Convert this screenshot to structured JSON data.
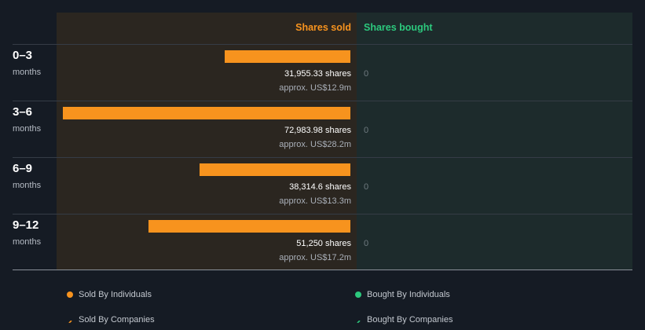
{
  "header": {
    "sold_label": "Shares sold",
    "bought_label": "Shares bought"
  },
  "rows": [
    {
      "period": "0–3",
      "unit": "months",
      "shares_text": "31,955.33 shares",
      "approx_text": "approx. US$12.9m",
      "bought_text": "0"
    },
    {
      "period": "3–6",
      "unit": "months",
      "shares_text": "72,983.98 shares",
      "approx_text": "approx. US$28.2m",
      "bought_text": "0"
    },
    {
      "period": "6–9",
      "unit": "months",
      "shares_text": "38,314.6 shares",
      "approx_text": "approx. US$13.3m",
      "bought_text": "0"
    },
    {
      "period": "9–12",
      "unit": "months",
      "shares_text": "51,250 shares",
      "approx_text": "approx. US$17.2m",
      "bought_text": "0"
    }
  ],
  "legend": {
    "sold_individuals": "Sold By Individuals",
    "sold_companies": "Sold By Companies",
    "bought_individuals": "Bought By Individuals",
    "bought_companies": "Bought By Companies"
  },
  "colors": {
    "sold": "#f7931e",
    "bought": "#2cc87d",
    "background": "#151b24",
    "sold_panel": "#2b2620",
    "bought_panel": "#1d2b2c"
  },
  "chart_data": {
    "type": "bar",
    "categories": [
      "0–3",
      "3–6",
      "6–9",
      "9–12"
    ],
    "series": [
      {
        "name": "Shares sold",
        "values": [
          31955.33,
          72983.98,
          38314.6,
          51250
        ]
      },
      {
        "name": "Shares bought",
        "values": [
          0,
          0,
          0,
          0
        ]
      }
    ],
    "value_usd_millions": [
      12.9,
      28.2,
      13.3,
      17.2
    ],
    "orientation": "horizontal"
  }
}
